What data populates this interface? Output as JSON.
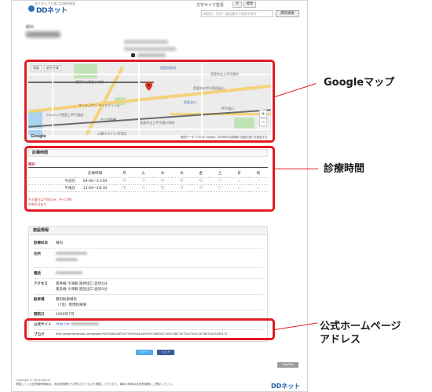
{
  "header": {
    "logo_sub": "ありがとうで選ぶ診療所検索",
    "logo_text": "DDネット",
    "font_size_label": "文字サイズ変更",
    "font_size_large": "大",
    "font_size_normal": "標準",
    "search_placeholder": "病院名・住所・電話番号で病院を探す",
    "search_button": "病院検索"
  },
  "clinic": {
    "breadcrumb": "眼科"
  },
  "map": {
    "toggle_map": "地図",
    "toggle_satellite": "航空写真",
    "labels": [
      "西宮市役所",
      "西宮市立上甲子園中",
      "西宮市立春風小学校",
      "サーティワン アイスクリーム",
      "ヤマダ電機",
      "西宮北口",
      "甲子園口",
      "ウエルシア西宮上甲子園店",
      "山陽マルナカ 西宮店",
      "西宮市立上甲子園小学校",
      "西宮市立甲子園浜田小"
    ],
    "footer": "地図データ ©2016 Google, ZENRIN  利用規約  地図の誤りを報告する",
    "google_logo": "Google",
    "zoom_in": "+",
    "zoom_out": "−"
  },
  "hours": {
    "title": "診療時間",
    "section": "眼科",
    "columns": [
      "診療時間",
      "月",
      "火",
      "水",
      "木",
      "金",
      "土",
      "日",
      "祝"
    ],
    "rows": [
      {
        "label": "午前診",
        "time": "09:00〜13:00",
        "marks": [
          "○",
          "○",
          "○",
          "○",
          "○",
          "○",
          "／",
          "／"
        ]
      },
      {
        "label": "午後診",
        "time": "15:00〜18:30",
        "marks": [
          "○",
          "○",
          "○",
          "○",
          "○",
          "○",
          "／",
          "／"
        ]
      }
    ],
    "notes": [
      "※土曜日は午前のみ、9〜13時",
      "※休診日あり"
    ]
  },
  "info": {
    "title": "施設情報",
    "subject_label": "診療科目",
    "subject_value": "眼科",
    "address_label": "住所",
    "phone_label": "電話",
    "access_label": "アクセス",
    "access_lines": [
      "阪神線 今津駅 阪神出口 徒歩2分",
      "阪急線 今津駅 阪急出口 徒歩2分"
    ],
    "parking_label": "駐車場",
    "parking_lines": [
      "無料駐車場有",
      "（7台）専用駐車場"
    ],
    "opened_label": "開院日",
    "opened_value": "2009年7月",
    "website_label": "公式サイト",
    "website_value": "http://w",
    "blog_label": "ブログ",
    "blog_value": "http://www.facebook.com/pages/%E5%8D%8E%E7%9A%84%E5%9C%B0%E7%9C%BC%E7%A7%91/1078070243439171"
  },
  "footer": {
    "tweet": "ツイート",
    "share": "シェア",
    "pagetop": "PageTop",
    "copyright": "Copyright © 2016 DDnet",
    "disclaimer": "掲載している医療機関情報は、各医療機関から提供されたものを掲載しております。最新の情報は各医療機関にご確認ください。",
    "logo": "DDネット"
  },
  "callouts": {
    "google_map": "Googleマップ",
    "hours": "診療時間",
    "website": [
      "公式ホームページ",
      "アドレス"
    ]
  },
  "colors": {
    "highlight": "#e11b22",
    "link": "#2b5db8",
    "brand": "#1f5fa8"
  }
}
